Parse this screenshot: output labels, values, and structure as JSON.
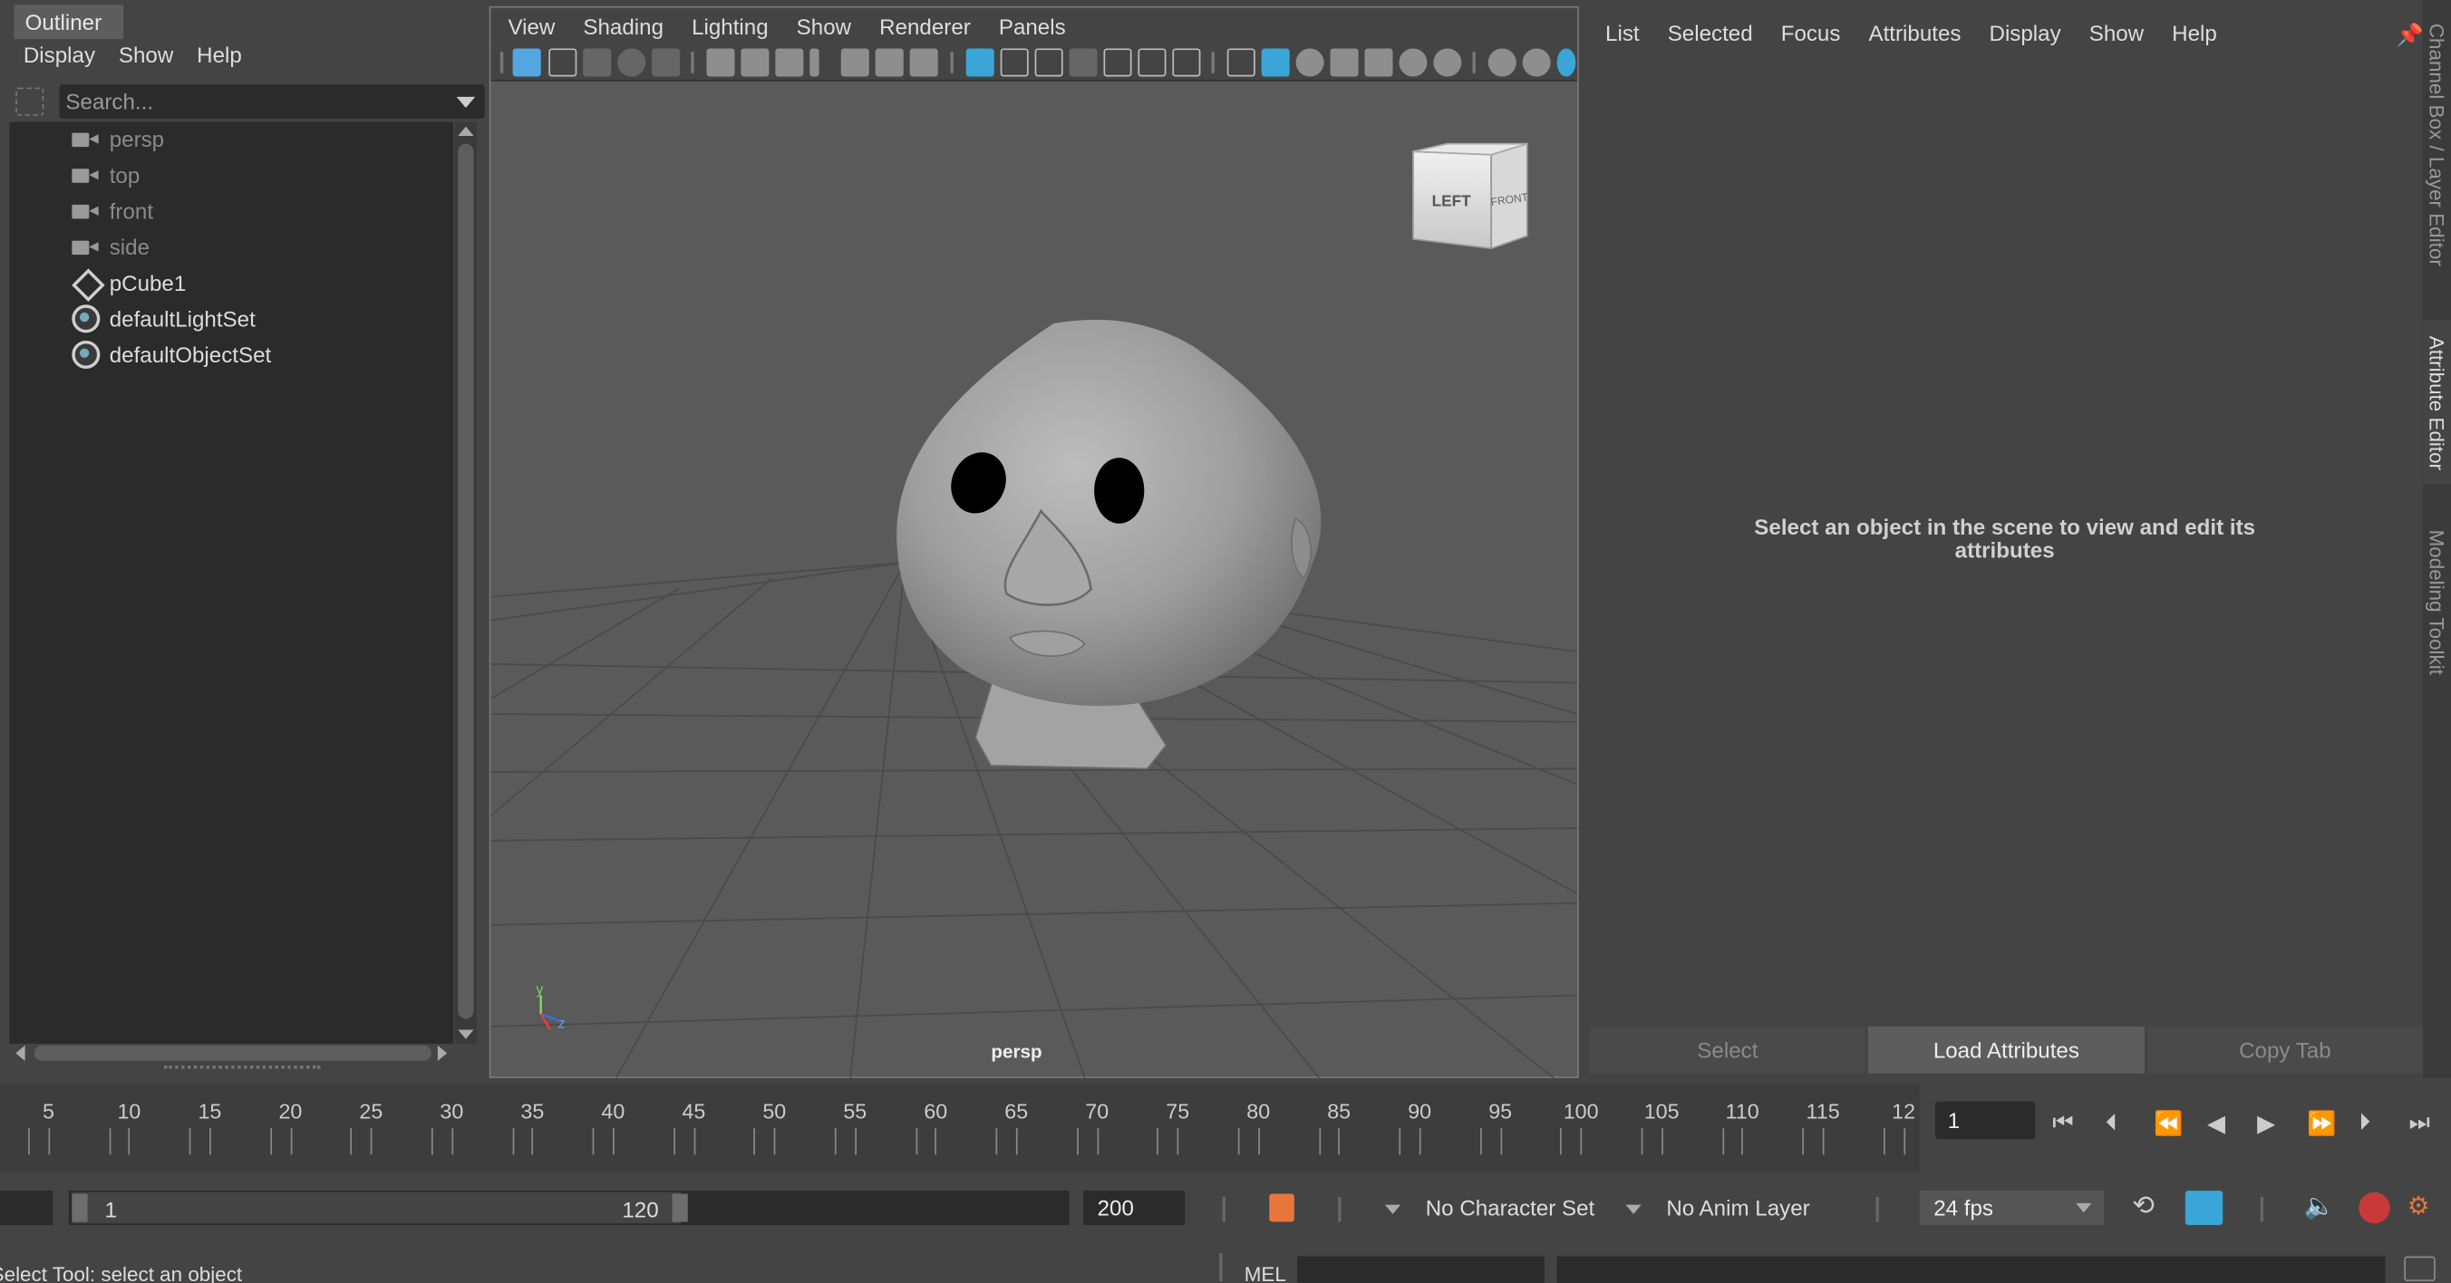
{
  "outliner": {
    "title": "Outliner",
    "menu": [
      "Display",
      "Show",
      "Help"
    ],
    "search_placeholder": "Search...",
    "items": [
      {
        "label": "persp",
        "icon": "camera-icon"
      },
      {
        "label": "top",
        "icon": "camera-icon"
      },
      {
        "label": "front",
        "icon": "camera-icon"
      },
      {
        "label": "side",
        "icon": "camera-icon"
      },
      {
        "label": "pCube1",
        "icon": "mesh-icon"
      },
      {
        "label": "defaultLightSet",
        "icon": "set-icon"
      },
      {
        "label": "defaultObjectSet",
        "icon": "set-icon"
      }
    ]
  },
  "viewport": {
    "menu": [
      "View",
      "Shading",
      "Lighting",
      "Show",
      "Renderer",
      "Panels"
    ],
    "camera_label": "persp",
    "viewcube": {
      "left": "LEFT",
      "front": "FRONT"
    },
    "axis": {
      "y": "y",
      "z": "z"
    }
  },
  "attribute_editor": {
    "menu": [
      "List",
      "Selected",
      "Focus",
      "Attributes",
      "Display",
      "Show",
      "Help"
    ],
    "message_line1": "Select an object in the scene to view and edit its",
    "message_line2": "attributes",
    "buttons": {
      "select": "Select",
      "load": "Load Attributes",
      "copy": "Copy Tab"
    }
  },
  "side_tabs": {
    "channel_box": "Channel Box / Layer Editor",
    "attribute_editor": "Attribute Editor",
    "modeling_toolkit": "Modeling Toolkit"
  },
  "timeline": {
    "ticks": [
      "5",
      "10",
      "15",
      "20",
      "25",
      "30",
      "35",
      "40",
      "45",
      "50",
      "55",
      "60",
      "65",
      "70",
      "75",
      "80",
      "85",
      "90",
      "95",
      "100",
      "105",
      "110",
      "115",
      "12"
    ],
    "current_frame": "1"
  },
  "range": {
    "start": "1",
    "end": "120",
    "anim_end": "200",
    "character_set": "No Character Set",
    "anim_layer": "No Anim Layer",
    "fps": "24 fps"
  },
  "command_line": {
    "status": "Select Tool: select an object",
    "lang": "MEL"
  },
  "colors": {
    "accent": "#3aa5d7",
    "key_marker": "#e8763a",
    "panel": "#444444",
    "field": "#2b2b2b"
  }
}
